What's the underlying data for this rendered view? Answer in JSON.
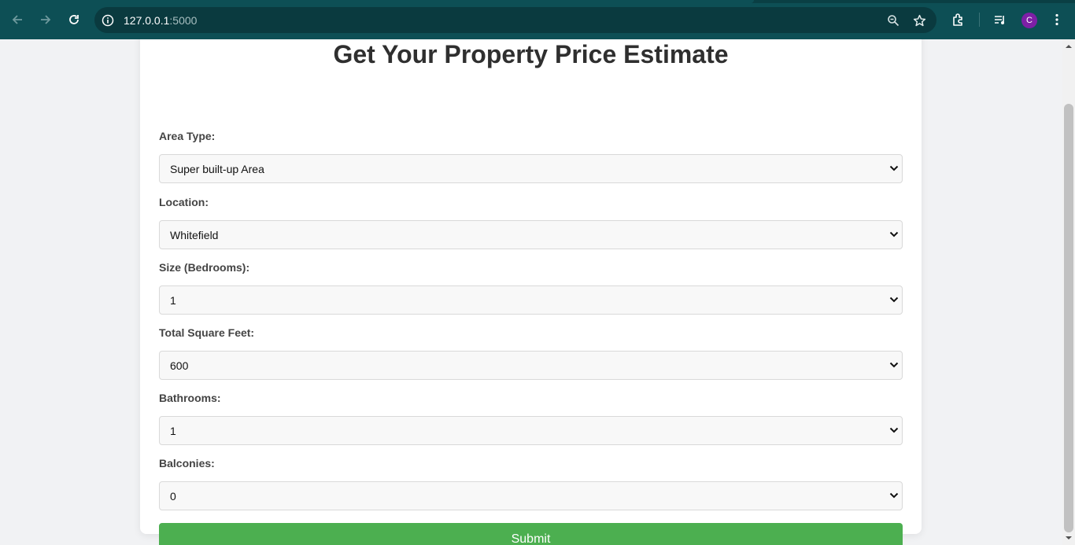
{
  "browser": {
    "url_host": "127.0.0.1",
    "url_port": ":5000",
    "avatar_letter": "C",
    "icons": [
      "back-icon",
      "forward-icon",
      "reload-icon",
      "site-info-icon",
      "zoom-icon",
      "bookmark-star-icon",
      "extensions-icon",
      "media-control-icon",
      "menu-dots-icon"
    ]
  },
  "form": {
    "title": "Get Your Property Price Estimate",
    "fields": [
      {
        "label": "Area Type:",
        "value": "Super built-up Area"
      },
      {
        "label": "Location:",
        "value": "Whitefield"
      },
      {
        "label": "Size (Bedrooms):",
        "value": "1"
      },
      {
        "label": "Total Square Feet:",
        "value": "600"
      },
      {
        "label": "Bathrooms:",
        "value": "1"
      },
      {
        "label": "Balconies:",
        "value": "0"
      }
    ],
    "submit_label": "Submit"
  },
  "colors": {
    "toolbar": "#0d4f55",
    "submit": "#4caf50",
    "avatar": "#7e1fa6"
  }
}
